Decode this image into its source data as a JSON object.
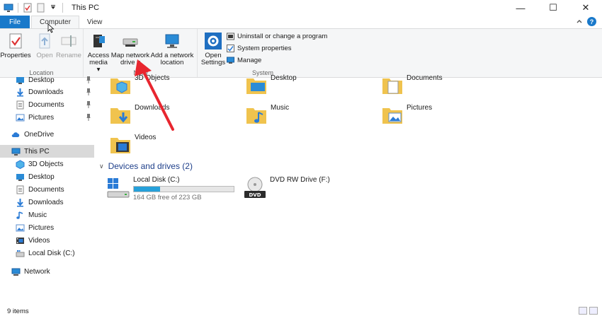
{
  "window": {
    "title": "This PC",
    "controls": [
      "minimize",
      "maximize",
      "close"
    ]
  },
  "ribbon_tabs": [
    {
      "label": "File"
    },
    {
      "label": "Computer"
    },
    {
      "label": "View"
    }
  ],
  "ribbon": {
    "location_group": {
      "label": "Location",
      "properties": "Properties",
      "open": "Open",
      "rename": "Rename"
    },
    "network_group": {
      "label": "Netw",
      "access_media": [
        "Access",
        "media ▾"
      ],
      "map_network_drive": [
        "Map network",
        "drive ▾"
      ],
      "add_network_location": [
        "Add a network",
        "location"
      ]
    },
    "system_group": {
      "label": "System",
      "open_settings": [
        "Open",
        "Settings"
      ],
      "uninstall": "Uninstall or change a program",
      "system_properties": "System properties",
      "manage": "Manage"
    }
  },
  "nav": {
    "quick_access": [
      {
        "label": "Desktop",
        "icon": "desktop-icon",
        "pinned": true
      },
      {
        "label": "Downloads",
        "icon": "downloads-icon",
        "pinned": true
      },
      {
        "label": "Documents",
        "icon": "documents-icon",
        "pinned": true
      },
      {
        "label": "Pictures",
        "icon": "pictures-icon",
        "pinned": true
      }
    ],
    "onedrive": "OneDrive",
    "this_pc": "This PC",
    "this_pc_children": [
      {
        "label": "3D Objects",
        "icon": "3d-objects-icon"
      },
      {
        "label": "Desktop",
        "icon": "desktop-icon"
      },
      {
        "label": "Documents",
        "icon": "documents-icon"
      },
      {
        "label": "Downloads",
        "icon": "downloads-icon"
      },
      {
        "label": "Music",
        "icon": "music-icon"
      },
      {
        "label": "Pictures",
        "icon": "pictures-icon"
      },
      {
        "label": "Videos",
        "icon": "videos-icon"
      },
      {
        "label": "Local Disk (C:)",
        "icon": "local-disk-icon"
      }
    ],
    "network": "Network"
  },
  "folders": [
    {
      "label": "3D Objects",
      "icon": "3d-objects-folder-icon"
    },
    {
      "label": "Desktop",
      "icon": "desktop-folder-icon"
    },
    {
      "label": "Documents",
      "icon": "documents-folder-icon"
    },
    {
      "label": "Downloads",
      "icon": "downloads-folder-icon"
    },
    {
      "label": "Music",
      "icon": "music-folder-icon"
    },
    {
      "label": "Pictures",
      "icon": "pictures-folder-icon"
    },
    {
      "label": "Videos",
      "icon": "videos-folder-icon"
    }
  ],
  "devices_section": "Devices and drives (2)",
  "drives": [
    {
      "label": "Local Disk (C:)",
      "free_text": "164 GB free of 223 GB",
      "used_fraction": 0.26,
      "icon": "windows-drive-icon"
    },
    {
      "label": "DVD RW Drive (F:)",
      "icon": "dvd-drive-icon"
    }
  ],
  "status": {
    "items": "9 items"
  },
  "colors": {
    "accent": "#1979ca",
    "drive_bar": "#26a0da",
    "annotation_arrow": "#e8262f",
    "section_heading": "#1e3f8a"
  }
}
